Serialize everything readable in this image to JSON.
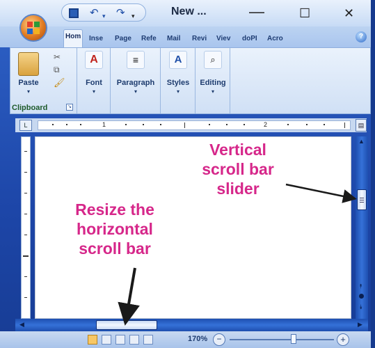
{
  "window": {
    "doc_title": "New ...",
    "qat_undo_icon": "undo-icon",
    "qat_redo_icon": "redo-icon",
    "minimize_glyph": "—",
    "maximize_glyph": "☐",
    "close_glyph": "✕"
  },
  "ribbon_tabs": [
    {
      "label": "Hom",
      "active": true
    },
    {
      "label": "Inse",
      "active": false
    },
    {
      "label": "Page",
      "active": false
    },
    {
      "label": "Refe",
      "active": false
    },
    {
      "label": "Mail",
      "active": false
    },
    {
      "label": "Revi",
      "active": false
    },
    {
      "label": "Viev",
      "active": false
    },
    {
      "label": "doPI",
      "active": false
    },
    {
      "label": "Acro",
      "active": false
    }
  ],
  "ribbon": {
    "paste_label": "Paste",
    "clipboard_label": "Clipboard",
    "font_label": "Font",
    "paragraph_label": "Paragraph",
    "styles_label": "Styles",
    "editing_label": "Editing",
    "dropdown_glyph": "▾"
  },
  "ruler": {
    "tab_selector_glyph": "L",
    "numbers": [
      "1",
      "2"
    ]
  },
  "status": {
    "zoom_level": "170%",
    "zoom_out_glyph": "−",
    "zoom_in_glyph": "+"
  },
  "annotations": {
    "vertical_slider": [
      "Vertical",
      "scroll bar",
      "slider"
    ],
    "resize_horizontal": [
      "Resize the",
      "horizontal",
      "scroll bar"
    ]
  },
  "colors": {
    "annotation": "#d6278a",
    "frame": "#1d46a8",
    "ribbon": "#d0e0f5"
  }
}
